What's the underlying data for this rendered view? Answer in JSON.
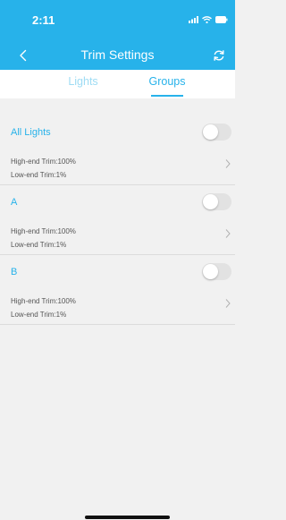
{
  "status_bar": {
    "time": "2:11",
    "signal_icon": "cellular-signal-icon",
    "wifi_icon": "wifi-icon",
    "battery_icon": "battery-icon"
  },
  "nav": {
    "title": "Trim Settings",
    "back_icon": "chevron-left-icon",
    "refresh_icon": "refresh-icon"
  },
  "tabs": [
    {
      "label": "Lights",
      "active": false
    },
    {
      "label": "Groups",
      "active": true
    }
  ],
  "groups": [
    {
      "name": "All Lights",
      "enabled": false,
      "high_end_trim": "High-end Trim:100%",
      "low_end_trim": "Low-end Trim:1%"
    },
    {
      "name": "A",
      "enabled": false,
      "high_end_trim": "High-end Trim:100%",
      "low_end_trim": "Low-end Trim:1%"
    },
    {
      "name": "B",
      "enabled": false,
      "high_end_trim": "High-end Trim:100%",
      "low_end_trim": "Low-end Trim:1%"
    }
  ],
  "colors": {
    "accent": "#27b2ea",
    "tab_inactive": "#9edcf4",
    "background": "#f1f1f1"
  }
}
